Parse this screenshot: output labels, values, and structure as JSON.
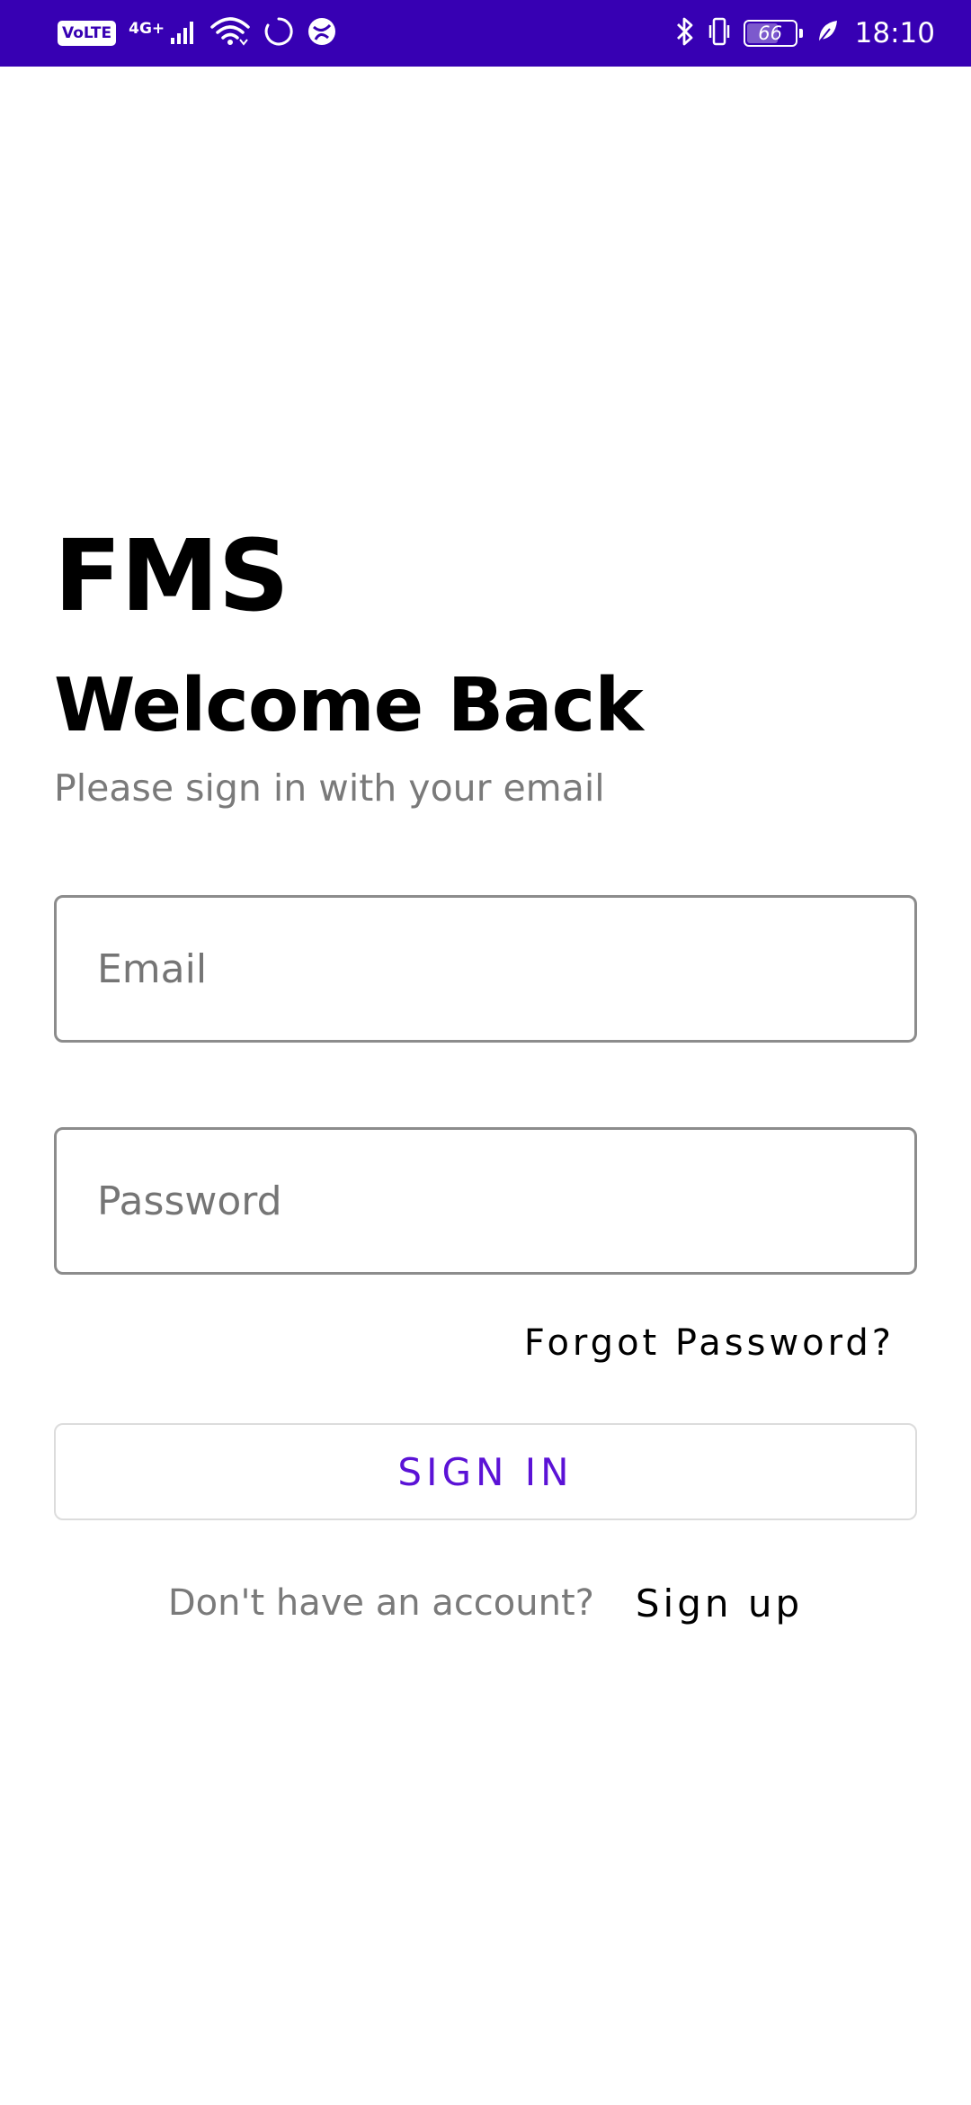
{
  "status_bar": {
    "volte": "VoLTE",
    "network_type": "4G+",
    "battery_level": "66",
    "battery_fraction": 0.66,
    "time": "18:10",
    "background_color": "#3700b3"
  },
  "login": {
    "app_name": "FMS",
    "heading": "Welcome Back",
    "subtitle": "Please sign in with your email",
    "email_placeholder": "Email",
    "email_value": "",
    "password_placeholder": "Password",
    "password_value": "",
    "forgot_password": "Forgot Password?",
    "sign_in": "SIGN IN",
    "no_account": "Don't have an account?",
    "sign_up": "Sign up"
  },
  "colors": {
    "accent": "#5b12d6",
    "status_bar": "#3700b3",
    "muted_text": "#7a7a7a"
  },
  "icons": [
    "volte-icon",
    "signal-icon",
    "wifi-icon",
    "sync-icon",
    "app-notification-icon",
    "bluetooth-icon",
    "vibrate-icon",
    "battery-icon",
    "power-saving-leaf-icon"
  ]
}
